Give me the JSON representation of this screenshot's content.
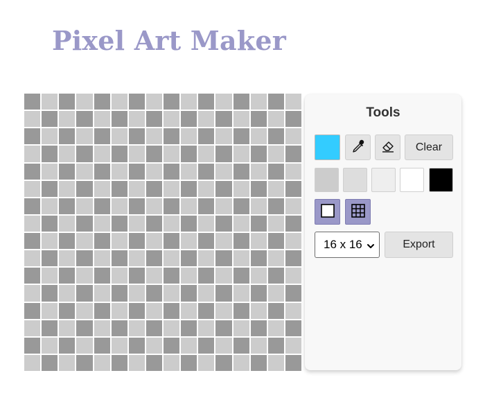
{
  "header": {
    "title": "Pixel Art Maker"
  },
  "canvas": {
    "size": 16,
    "colors": {
      "dark": "#999999",
      "light": "#cccccc",
      "gap": "#ffffff"
    }
  },
  "tools": {
    "title": "Tools",
    "current_color": "#33ccff",
    "eyedropper_icon": "eyedropper-icon",
    "eraser_icon": "eraser-icon",
    "clear_label": "Clear",
    "palette": [
      "#cccccc",
      "#dddddd",
      "#eeeeee",
      "#ffffff",
      "#000000"
    ],
    "toggle_border_icon": "square-outline-icon",
    "toggle_grid_icon": "grid-icon",
    "grid_size": {
      "selected": "16 x 16"
    },
    "export_label": "Export"
  },
  "accent": "#9a98c8"
}
